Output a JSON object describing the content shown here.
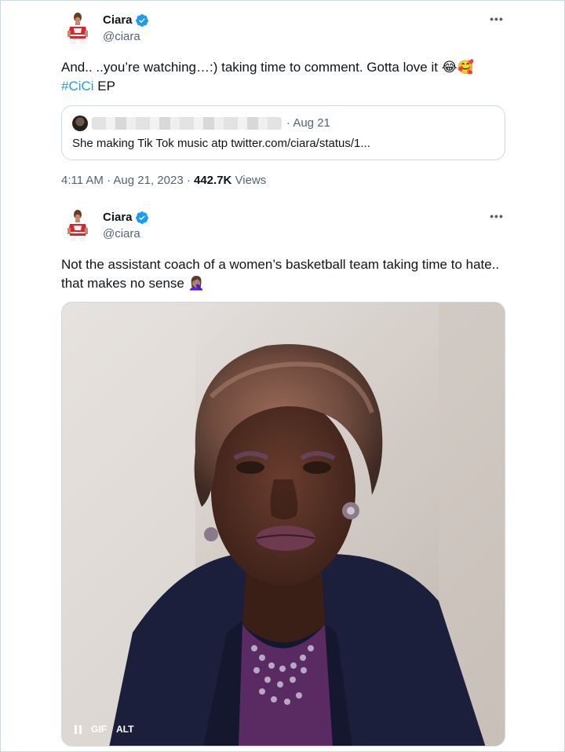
{
  "tweets": [
    {
      "display_name": "Ciara",
      "handle": "@ciara",
      "more_icon": "more-horizontal-icon",
      "text_main": "And.. ..you’re watching…:) taking time to comment. Gotta love it ",
      "text_emojis": "😂🥰",
      "hashtag": "#CiCi",
      "text_after_hashtag": " EP",
      "quote": {
        "date": "· Aug 21",
        "text": "She making Tik Tok music atp twitter.com/ciara/status/1..."
      },
      "time": "4:11 AM · Aug 21, 2023 · ",
      "views_count": "442.7K",
      "views_label": " Views"
    },
    {
      "display_name": "Ciara",
      "handle": "@ciara",
      "more_icon": "more-horizontal-icon",
      "text_main": "Not the assistant coach of a women’s basketball team taking time to hate.. that makes no sense ",
      "text_emoji": "🤦🏽‍♀️",
      "media": {
        "type": "gif",
        "pause_icon": "pause-icon",
        "badge_gif": "GIF",
        "badge_alt": "ALT"
      }
    }
  ],
  "colors": {
    "link": "#1d9bf0",
    "secondary_text": "#536471",
    "border": "#cfd9de",
    "verified": "#1d9bf0"
  }
}
